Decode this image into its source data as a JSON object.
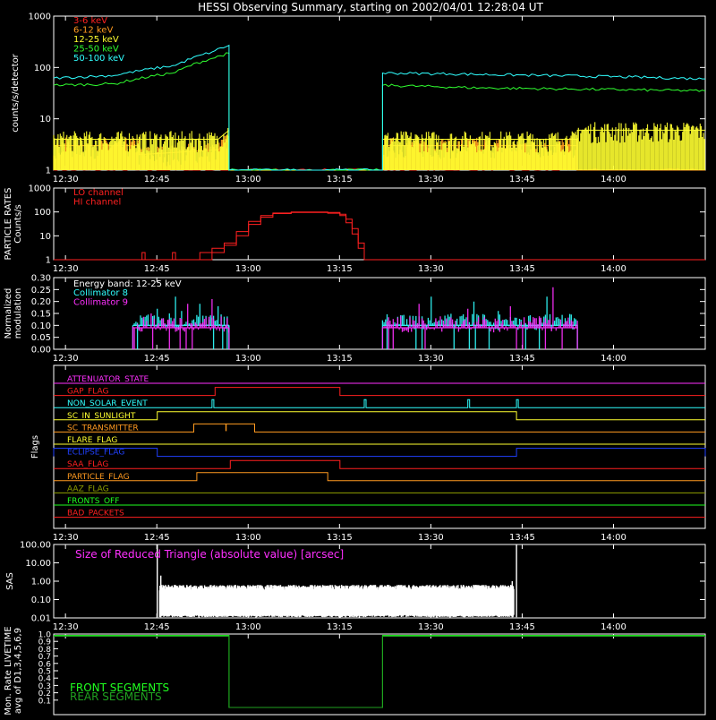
{
  "title": "HESSI Observing Summary, starting on 2002/04/01 12:28:04 UT",
  "time_ticks": [
    "12:30",
    "12:45",
    "13:00",
    "13:15",
    "13:30",
    "13:45",
    "14:00"
  ],
  "colors": {
    "background": "#000000",
    "axes": "#ffffff",
    "c3_6": "#ff2020",
    "c6_12": "#ff9a20",
    "c12_25": "#ffff30",
    "c25_50": "#30ff30",
    "c50_100": "#30ffff",
    "magenta": "#ff30ff",
    "blue": "#2040ff",
    "olive": "#90a000",
    "green": "#20ff20",
    "darkgreen": "#20a020"
  },
  "chart_data": [
    {
      "type": "line",
      "panel": "count_rates",
      "ylabel": "counts/s/detector",
      "yscale": "log",
      "ylim": [
        1,
        1000
      ],
      "y_ticks": [
        "1",
        "10",
        "100",
        "1000"
      ],
      "x_unit": "minutes from 12:28:04 UT",
      "xlim": [
        0,
        107
      ],
      "legend_position": "top-left",
      "series": [
        {
          "name": "3-6 keV",
          "color": "#ff2020",
          "points": [
            [
              0,
              1
            ],
            [
              107,
              1
            ]
          ]
        },
        {
          "name": "6-12 keV",
          "color": "#ff9a20",
          "points": [
            [
              0,
              3
            ],
            [
              14,
              3
            ],
            [
              14,
              2
            ],
            [
              27,
              2.5
            ],
            [
              28.8,
              4
            ],
            [
              28.8,
              1
            ],
            [
              54,
              1
            ],
            [
              54,
              3
            ],
            [
              86,
              3
            ],
            [
              86,
              1
            ],
            [
              107,
              1
            ]
          ]
        },
        {
          "name": "12-25 keV",
          "color": "#ffff30",
          "points": [
            [
              0,
              4
            ],
            [
              27,
              4
            ],
            [
              28.8,
              6
            ],
            [
              28.8,
              1
            ],
            [
              54,
              1
            ],
            [
              54,
              4
            ],
            [
              86,
              4
            ],
            [
              86,
              6
            ],
            [
              107,
              6
            ]
          ]
        },
        {
          "name": "25-50 keV",
          "color": "#30ff30",
          "points": [
            [
              0,
              45
            ],
            [
              10,
              48
            ],
            [
              20,
              80
            ],
            [
              26,
              150
            ],
            [
              28.8,
              190
            ],
            [
              28.8,
              1
            ],
            [
              54,
              1
            ],
            [
              54,
              45
            ],
            [
              70,
              40
            ],
            [
              85,
              38
            ],
            [
              107,
              35
            ]
          ]
        },
        {
          "name": "50-100 keV",
          "color": "#30ffff",
          "points": [
            [
              0,
              62
            ],
            [
              10,
              70
            ],
            [
              20,
              110
            ],
            [
              26,
              200
            ],
            [
              28.8,
              270
            ],
            [
              28.8,
              1
            ],
            [
              54,
              1
            ],
            [
              54,
              78
            ],
            [
              65,
              75
            ],
            [
              80,
              70
            ],
            [
              95,
              65
            ],
            [
              107,
              60
            ]
          ]
        }
      ]
    },
    {
      "type": "line",
      "panel": "particle_rates",
      "ylabel": "PARTICLE RATES Counts/s",
      "yscale": "log",
      "ylim": [
        1,
        1000
      ],
      "y_ticks": [
        "1",
        "10",
        "100",
        "1000"
      ],
      "x_unit": "minutes from 12:28:04 UT",
      "xlim": [
        0,
        107
      ],
      "legend_position": "top-left",
      "series": [
        {
          "name": "LO channel",
          "color": "#ff2020",
          "points": [
            [
              0,
              1
            ],
            [
              14,
              1
            ],
            [
              14.5,
              2
            ],
            [
              15,
              1
            ],
            [
              19,
              1
            ],
            [
              19.5,
              2
            ],
            [
              20,
              1
            ],
            [
              22,
              1
            ],
            [
              24,
              2
            ],
            [
              26,
              3
            ],
            [
              28,
              5
            ],
            [
              30,
              15
            ],
            [
              32,
              40
            ],
            [
              34,
              70
            ],
            [
              36,
              90
            ],
            [
              39,
              100
            ],
            [
              42,
              100
            ],
            [
              45,
              95
            ],
            [
              47,
              80
            ],
            [
              48,
              50
            ],
            [
              49,
              20
            ],
            [
              50,
              5
            ],
            [
              51,
              1
            ],
            [
              107,
              1
            ]
          ]
        },
        {
          "name": "HI channel",
          "color": "#ff2020",
          "points": [
            [
              0,
              1
            ],
            [
              24,
              1
            ],
            [
              26,
              2
            ],
            [
              28,
              4
            ],
            [
              30,
              10
            ],
            [
              32,
              30
            ],
            [
              34,
              60
            ],
            [
              36,
              85
            ],
            [
              39,
              95
            ],
            [
              42,
              95
            ],
            [
              45,
              88
            ],
            [
              47,
              70
            ],
            [
              48,
              35
            ],
            [
              49,
              12
            ],
            [
              50,
              3
            ],
            [
              51,
              1
            ],
            [
              107,
              1
            ]
          ]
        }
      ]
    },
    {
      "type": "line",
      "panel": "modulation",
      "ylabel": "Normalized modulation",
      "ylim": [
        0,
        0.3
      ],
      "y_ticks": [
        "0.00",
        "0.05",
        "0.10",
        "0.15",
        "0.20",
        "0.25",
        "0.30"
      ],
      "x_unit": "minutes from 12:28:04 UT",
      "xlim": [
        0,
        107
      ],
      "legend_position": "top-left",
      "annotation": "Energy band: 12-25 keV",
      "windows": [
        [
          13,
          28.8
        ],
        [
          54,
          86
        ]
      ],
      "series": [
        {
          "name": "Collimator 8",
          "color": "#30ffff",
          "typical": 0.1,
          "spikes": [
            [
              17,
              0.17
            ],
            [
              19,
              0.15
            ],
            [
              20,
              0.22
            ],
            [
              21,
              0.16
            ],
            [
              24,
              0.19
            ],
            [
              25,
              0.14
            ],
            [
              27,
              0.18
            ],
            [
              59,
              0.14
            ],
            [
              62,
              0.22
            ],
            [
              66,
              0.12
            ],
            [
              69,
              0.2
            ],
            [
              73,
              0.16
            ],
            [
              78,
              0.14
            ],
            [
              81,
              0.22
            ],
            [
              84,
              0.13
            ]
          ]
        },
        {
          "name": "Collimator 9",
          "color": "#ff30ff",
          "typical": 0.09,
          "spikes": [
            [
              16,
              0.15
            ],
            [
              18,
              0.13
            ],
            [
              22,
              0.19
            ],
            [
              26,
              0.21
            ],
            [
              27.5,
              0.13
            ],
            [
              57,
              0.14
            ],
            [
              60,
              0.19
            ],
            [
              64,
              0.12
            ],
            [
              68,
              0.17
            ],
            [
              71,
              0.12
            ],
            [
              75,
              0.18
            ],
            [
              79,
              0.13
            ],
            [
              82,
              0.26
            ],
            [
              85,
              0.11
            ]
          ]
        }
      ]
    },
    {
      "type": "line",
      "panel": "flags",
      "ylabel": "Flags",
      "x_unit": "minutes from 12:28:04 UT",
      "xlim": [
        0,
        107
      ],
      "series": [
        {
          "name": "ATTENUATOR_STATE",
          "color": "#ff30ff",
          "on": []
        },
        {
          "name": "GAP_FLAG",
          "color": "#ff2020",
          "on": [
            [
              26.5,
              47
            ]
          ]
        },
        {
          "name": "NON_SOLAR_EVENT",
          "color": "#30ffff",
          "on": [
            [
              26,
              26.3
            ],
            [
              51,
              51.3
            ],
            [
              68,
              68.3
            ],
            [
              76,
              76.3
            ]
          ]
        },
        {
          "name": "SC_IN_SUNLIGHT",
          "color": "#ffff30",
          "on": [
            [
              17,
              76
            ]
          ]
        },
        {
          "name": "SC_TRANSMITTER",
          "color": "#ff9a20",
          "on": [
            [
              23,
              33
            ]
          ],
          "marks": [
            28.3
          ]
        },
        {
          "name": "FLARE_FLAG",
          "color": "#ffff30",
          "on": []
        },
        {
          "name": "ECLIPSE_FLAG",
          "color": "#2040ff",
          "on": [
            [
              0,
              17
            ],
            [
              76,
              107
            ]
          ]
        },
        {
          "name": "SAA_FLAG",
          "color": "#ff2020",
          "on": [
            [
              29,
              47
            ]
          ]
        },
        {
          "name": "PARTICLE_FLAG",
          "color": "#ff9a20",
          "on": [
            [
              23.5,
              45
            ]
          ]
        },
        {
          "name": "AAZ_FLAG",
          "color": "#90a000",
          "on": []
        },
        {
          "name": "FRONTS_OFF",
          "color": "#20ff20",
          "on": []
        },
        {
          "name": "BAD_PACKETS",
          "color": "#ff2020",
          "on": []
        }
      ]
    },
    {
      "type": "line",
      "panel": "sas",
      "ylabel": "SAS",
      "yscale": "log",
      "ylim": [
        0.01,
        100
      ],
      "y_ticks": [
        "0.01",
        "0.10",
        "1.00",
        "10.00",
        "100.00"
      ],
      "x_unit": "minutes from 12:28:04 UT",
      "xlim": [
        0,
        107
      ],
      "annotation": "Size of Reduced Triangle (absolute value) [arcsec]",
      "series": [
        {
          "name": "SAS",
          "color": "#ffffff",
          "active": [
            17,
            76
          ],
          "typical": 0.35,
          "edges": [
            [
              17,
              100
            ],
            [
              17.6,
              2
            ],
            [
              75.3,
              1
            ],
            [
              76,
              100
            ]
          ]
        }
      ]
    },
    {
      "type": "line",
      "panel": "livetime",
      "ylabel": "Mon. Rate LIVETIME avg of D1,3,4,5,6,9",
      "ylim": [
        0,
        1
      ],
      "y_ticks": [
        "0.1",
        "0.2",
        "0.3",
        "0.4",
        "0.5",
        "0.6",
        "0.7",
        "0.8",
        "0.9",
        "1.0"
      ],
      "x_unit": "minutes from 12:28:04 UT",
      "xlim": [
        0,
        107
      ],
      "legend_position": "bottom-left",
      "series": [
        {
          "name": "FRONT SEGMENTS",
          "color": "#20ff20",
          "points": [
            [
              0,
              0.98
            ],
            [
              28.8,
              0.98
            ],
            [
              28.8,
              0
            ],
            [
              54,
              0
            ],
            [
              54,
              0.98
            ],
            [
              107,
              0.98
            ]
          ]
        },
        {
          "name": "REAR SEGMENTS",
          "color": "#20a020",
          "points": [
            [
              0,
              0.97
            ],
            [
              28.8,
              0.97
            ],
            [
              28.8,
              0
            ],
            [
              54,
              0
            ],
            [
              54,
              0.97
            ],
            [
              107,
              0.97
            ]
          ]
        }
      ]
    }
  ]
}
